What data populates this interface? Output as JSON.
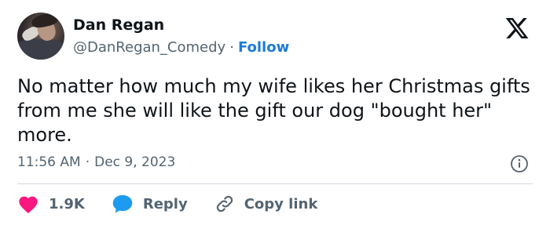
{
  "tweet": {
    "author_name": "Dan Regan",
    "author_handle": "@DanRegan_Comedy",
    "separator": "·",
    "follow_label": "Follow",
    "text": "No matter how much my wife likes her Christmas gifts from me she will like the gift our dog \"bought her\" more.",
    "time": "11:56 AM",
    "date": "Dec 9, 2023"
  },
  "actions": {
    "like_count": "1.9K",
    "reply_label": "Reply",
    "copy_label": "Copy link"
  },
  "colors": {
    "accent": "#1d7bd7",
    "like": "#f91880",
    "text": "#0f1419",
    "muted": "#536471"
  },
  "icons": [
    "x-logo-icon",
    "info-icon",
    "heart-icon",
    "reply-bubble-icon",
    "link-icon"
  ]
}
